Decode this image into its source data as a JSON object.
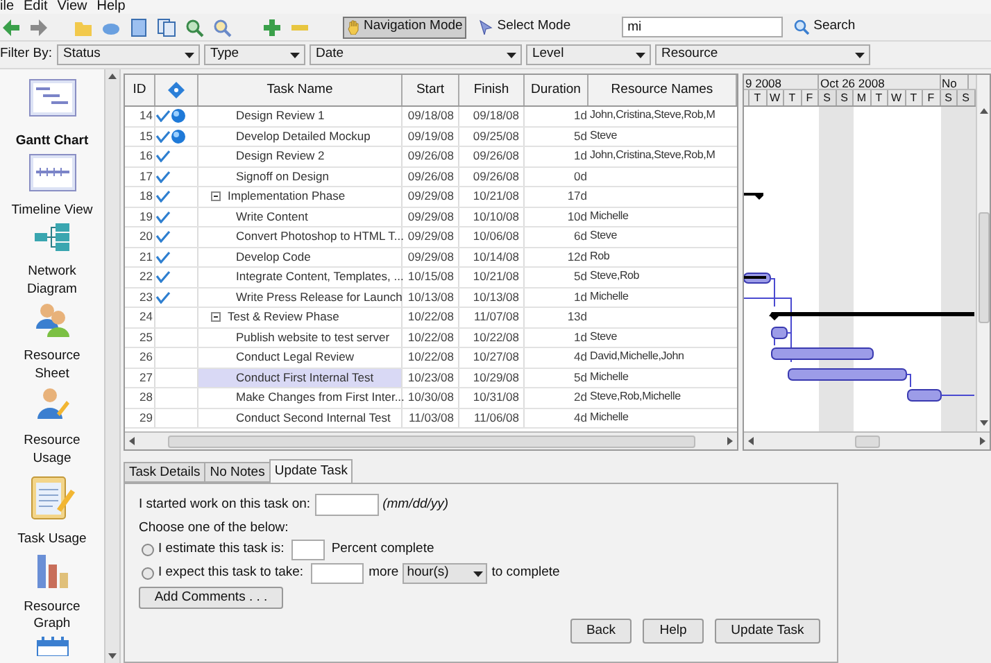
{
  "menu": [
    "ile",
    "Edit",
    "View",
    "Help"
  ],
  "toolbar": {
    "navigation_mode": {
      "label": "Navigation Mode",
      "selected": true
    },
    "select_mode": {
      "label": "Select Mode",
      "selected": false
    },
    "search_value": "mi",
    "search_button": "Search"
  },
  "filter_bar": {
    "label": "Filter By:",
    "filters": [
      "Status",
      "Type",
      "Date",
      "Level",
      "Resource"
    ]
  },
  "sidebar": {
    "items": [
      {
        "label": "Gantt Chart",
        "kind": "gantt",
        "selected": true
      },
      {
        "label": "Timeline View",
        "kind": "timeline",
        "selected": false
      },
      {
        "label": "Network Diagram",
        "kind": "network",
        "selected": false
      },
      {
        "label": "Resource Sheet",
        "kind": "resource-sheet",
        "selected": false
      },
      {
        "label": "Resource Usage",
        "kind": "resource-usage",
        "selected": false
      },
      {
        "label": "Task Usage",
        "kind": "task-usage",
        "selected": false
      },
      {
        "label": "Resource Graph",
        "kind": "resource-graph",
        "selected": false
      },
      {
        "kind": "calendar",
        "selected": false
      }
    ]
  },
  "table": {
    "columns": [
      "ID",
      "Task Name",
      "Start",
      "Finish",
      "Duration",
      "Resource Names"
    ],
    "rows": [
      {
        "id": "14",
        "done": true,
        "info": true,
        "kind": "task",
        "name": "Design Review 1",
        "start": "09/18/08",
        "finish": "09/18/08",
        "duration": "1d",
        "resources": "John,Cristina,Steve,Rob,M",
        "selected": false
      },
      {
        "id": "15",
        "done": true,
        "info": true,
        "kind": "task",
        "name": "Develop Detailed Mockup",
        "start": "09/19/08",
        "finish": "09/25/08",
        "duration": "5d",
        "resources": "Steve",
        "selected": false
      },
      {
        "id": "16",
        "done": true,
        "info": false,
        "kind": "task",
        "name": "Design Review 2",
        "start": "09/26/08",
        "finish": "09/26/08",
        "duration": "1d",
        "resources": "John,Cristina,Steve,Rob,M",
        "selected": false
      },
      {
        "id": "17",
        "done": true,
        "info": false,
        "kind": "task",
        "name": "Signoff on Design",
        "start": "09/26/08",
        "finish": "09/26/08",
        "duration": "0d",
        "resources": "",
        "selected": false
      },
      {
        "id": "18",
        "done": true,
        "info": false,
        "kind": "phase",
        "expanded": true,
        "name": "Implementation Phase",
        "start": "09/29/08",
        "finish": "10/21/08",
        "duration": "17d",
        "resources": "",
        "selected": false
      },
      {
        "id": "19",
        "done": true,
        "info": false,
        "kind": "task",
        "name": "Write Content",
        "start": "09/29/08",
        "finish": "10/10/08",
        "duration": "10d",
        "resources": "Michelle",
        "selected": false
      },
      {
        "id": "20",
        "done": true,
        "info": false,
        "kind": "task",
        "name": "Convert Photoshop to HTML T...",
        "start": "09/29/08",
        "finish": "10/06/08",
        "duration": "6d",
        "resources": "Steve",
        "selected": false
      },
      {
        "id": "21",
        "done": true,
        "info": false,
        "kind": "task",
        "name": "Develop Code",
        "start": "09/29/08",
        "finish": "10/14/08",
        "duration": "12d",
        "resources": "Rob",
        "selected": false
      },
      {
        "id": "22",
        "done": true,
        "info": false,
        "kind": "task",
        "name": "Integrate Content, Templates, ...",
        "start": "10/15/08",
        "finish": "10/21/08",
        "duration": "5d",
        "resources": "Steve,Rob",
        "selected": false
      },
      {
        "id": "23",
        "done": true,
        "info": false,
        "kind": "task",
        "name": "Write Press Release for Launch",
        "start": "10/13/08",
        "finish": "10/13/08",
        "duration": "1d",
        "resources": "Michelle",
        "selected": false
      },
      {
        "id": "24",
        "done": false,
        "info": false,
        "kind": "phase",
        "expanded": true,
        "name": "Test & Review Phase",
        "start": "10/22/08",
        "finish": "11/07/08",
        "duration": "13d",
        "resources": "",
        "selected": false
      },
      {
        "id": "25",
        "done": false,
        "info": false,
        "kind": "task",
        "name": "Publish website to test server",
        "start": "10/22/08",
        "finish": "10/22/08",
        "duration": "1d",
        "resources": "Steve",
        "selected": false
      },
      {
        "id": "26",
        "done": false,
        "info": false,
        "kind": "task",
        "name": "Conduct Legal Review",
        "start": "10/22/08",
        "finish": "10/27/08",
        "duration": "4d",
        "resources": "David,Michelle,John",
        "selected": false
      },
      {
        "id": "27",
        "done": false,
        "info": false,
        "kind": "task",
        "name": "Conduct First Internal Test",
        "start": "10/23/08",
        "finish": "10/29/08",
        "duration": "5d",
        "resources": "Michelle",
        "selected": true
      },
      {
        "id": "28",
        "done": false,
        "info": false,
        "kind": "task",
        "name": "Make Changes from First Inter...",
        "start": "10/30/08",
        "finish": "10/31/08",
        "duration": "2d",
        "resources": "Steve,Rob,Michelle",
        "selected": false
      },
      {
        "id": "29",
        "done": false,
        "info": false,
        "kind": "task",
        "name": "Conduct Second Internal Test",
        "start": "11/03/08",
        "finish": "11/06/08",
        "duration": "4d",
        "resources": "Michelle",
        "selected": false
      }
    ]
  },
  "gantt": {
    "weeks": [
      "9 2008",
      "Oct 26 2008",
      "No"
    ],
    "days": [
      {
        "label": "T",
        "weekend": false
      },
      {
        "label": "W",
        "weekend": false
      },
      {
        "label": "T",
        "weekend": false
      },
      {
        "label": "F",
        "weekend": false
      },
      {
        "label": "S",
        "weekend": true
      },
      {
        "label": "S",
        "weekend": true
      },
      {
        "label": "M",
        "weekend": false
      },
      {
        "label": "T",
        "weekend": false
      },
      {
        "label": "W",
        "weekend": false
      },
      {
        "label": "T",
        "weekend": false
      },
      {
        "label": "F",
        "weekend": false
      },
      {
        "label": "S",
        "weekend": true
      },
      {
        "label": "S",
        "weekend": true
      }
    ]
  },
  "tabs": [
    {
      "label": "Task Details",
      "selected": false
    },
    {
      "label": "No Notes",
      "selected": false
    },
    {
      "label": "Update Task",
      "selected": true
    }
  ],
  "update_form": {
    "started_label": "I started work on this task on:",
    "date_hint": "(mm/dd/yy)",
    "choose_label": "Choose one of the below:",
    "options": [
      {
        "kind": "percent",
        "label": "I estimate this task is:",
        "suffix": "Percent complete",
        "selected": false
      },
      {
        "kind": "remaining",
        "label": "I expect this task to take:",
        "middle": "more",
        "unit": "hour(s)",
        "suffix": "to complete",
        "selected": false
      }
    ],
    "comments_button": "Add Comments . . .",
    "buttons": [
      "Back",
      "Help",
      "Update Task"
    ]
  }
}
